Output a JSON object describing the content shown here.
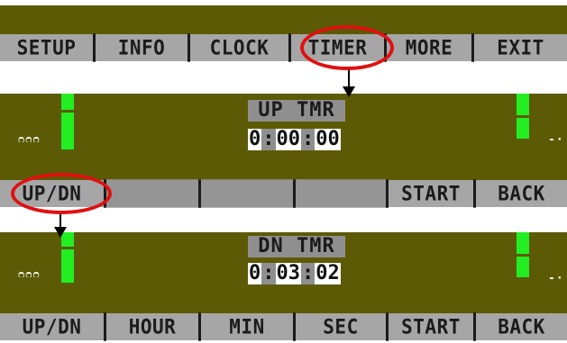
{
  "top_panel": {
    "menu": [
      "SETUP",
      "INFO",
      "CLOCK",
      "TIMER",
      "MORE",
      "EXIT"
    ]
  },
  "up_timer_panel": {
    "label": "UP TMR",
    "time": {
      "h": "0",
      "sep1": ":",
      "m": "00",
      "sep2": ":",
      "s": "00"
    },
    "left_glyph": "ᴒᴒᴒ",
    "right_glyph": "-·",
    "menu": [
      "UP/DN",
      "",
      "",
      "",
      "START",
      "BACK"
    ]
  },
  "down_timer_panel": {
    "label": "DN TMR",
    "time": {
      "h": "0",
      "sep1": ":",
      "m": "03",
      "sep2": ":",
      "s": "02"
    },
    "left_glyph": "ᴒᴒᴒ",
    "right_glyph": "-·",
    "menu": [
      "UP/DN",
      "HOUR",
      "MIN",
      "SEC",
      "START",
      "BACK"
    ]
  },
  "annotation_color": "#e01010",
  "display_color": "#5c5a05",
  "meter_color": "#22ee22"
}
